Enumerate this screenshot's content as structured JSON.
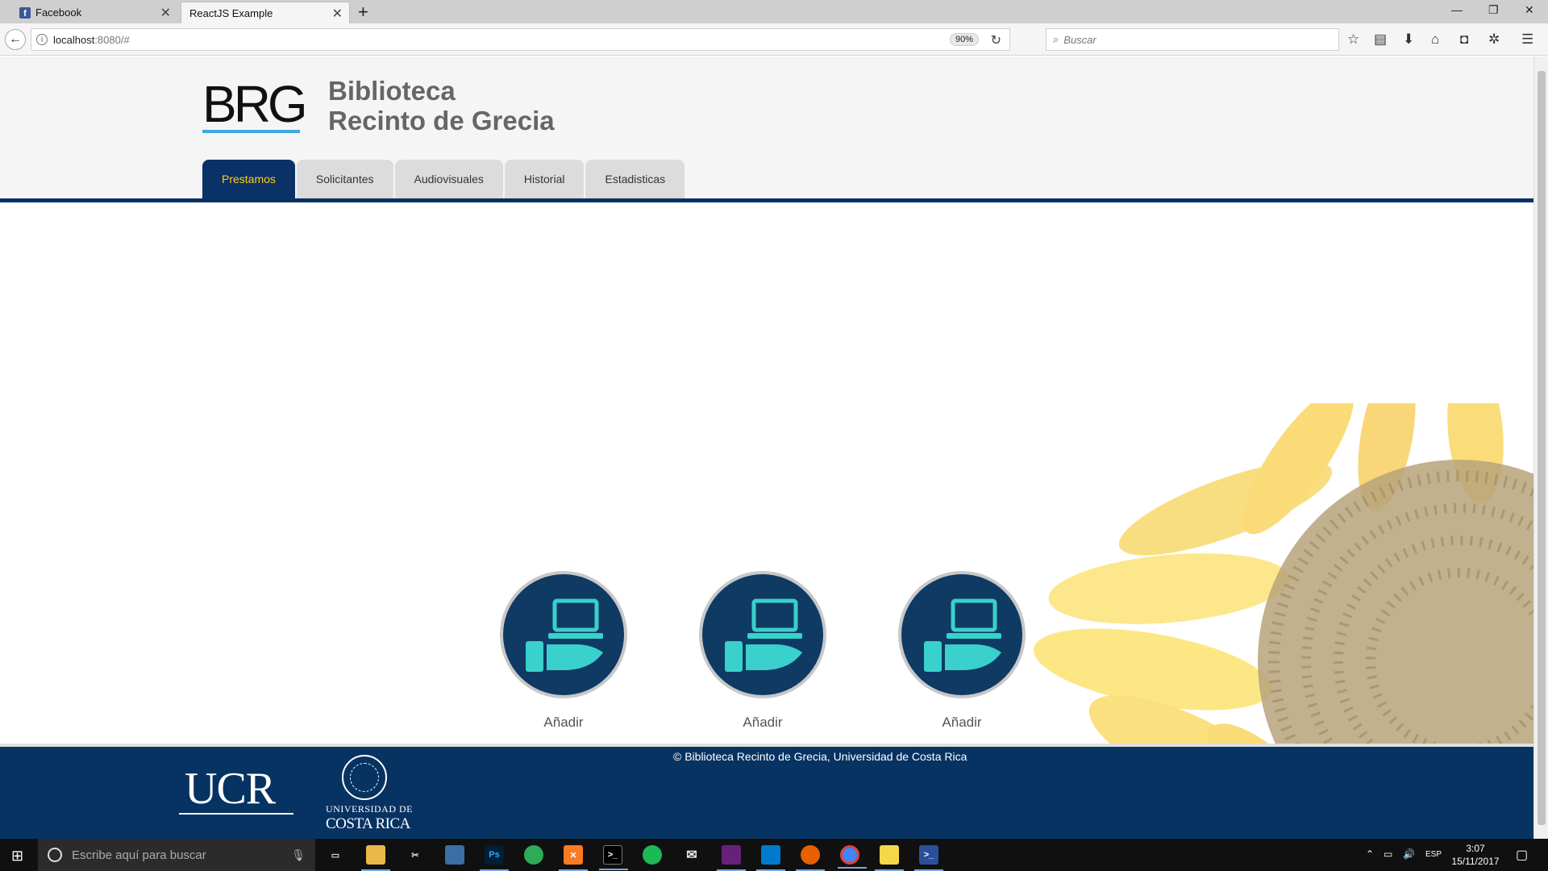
{
  "browser": {
    "tabs": [
      {
        "title": "Facebook"
      },
      {
        "title": "ReactJS Example"
      }
    ],
    "url_host": "localhost",
    "url_rest": ":8080/#",
    "zoom": "90%",
    "search_placeholder": "Buscar"
  },
  "site": {
    "logo_text": "BRG",
    "title_line1": "Biblioteca",
    "title_line2": "Recinto de Grecia",
    "nav": [
      {
        "label": "Prestamos",
        "active": true
      },
      {
        "label": "Solicitantes"
      },
      {
        "label": "Audiovisuales"
      },
      {
        "label": "Historial"
      },
      {
        "label": "Estadisticas"
      }
    ]
  },
  "actions": [
    {
      "label": "Añadir",
      "icon": "laptop-hand-icon"
    },
    {
      "label": "Añadir",
      "icon": "laptop-hand-icon"
    },
    {
      "label": "Añadir",
      "icon": "laptop-hand-icon"
    }
  ],
  "footer": {
    "copyright": "© Biblioteca Recinto de Grecia, Universidad de Costa Rica",
    "ucr_logo": "UCR",
    "ucr_name_line1": "UNIVERSIDAD DE",
    "ucr_name_line2": "COSTA RICA"
  },
  "taskbar": {
    "search_placeholder": "Escribe aquí para buscar",
    "language": "ESP",
    "time": "3:07",
    "date": "15/11/2017"
  },
  "colors": {
    "primary": "#0b3266",
    "active_tab_text": "#ffcc1a",
    "accent_blue": "#3fa9e0",
    "icon_teal": "#3ad0cc"
  }
}
